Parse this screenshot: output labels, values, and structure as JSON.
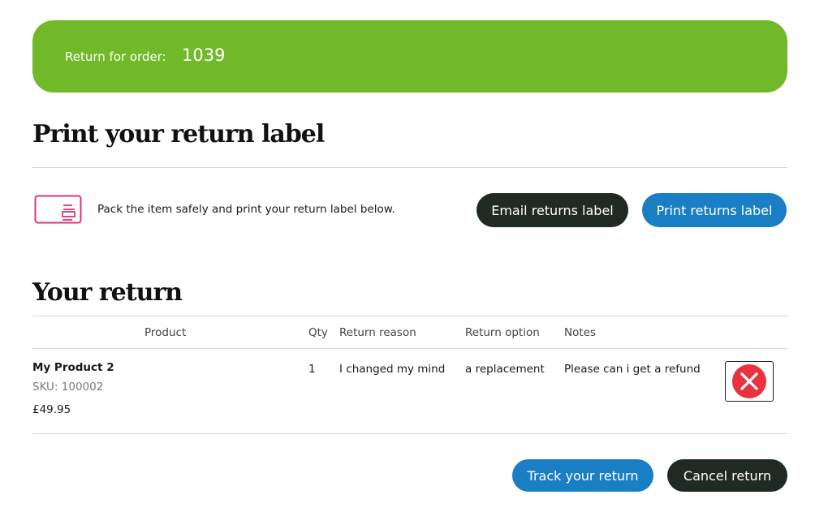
{
  "banner": {
    "label": "Return for order:",
    "order_number": "1039"
  },
  "print_section": {
    "title": "Print your return label",
    "instruction": "Pack the item safely and print your return label below.",
    "email_button": "Email returns label",
    "print_button": "Print returns label"
  },
  "return_section": {
    "title": "Your return",
    "columns": {
      "product": "Product",
      "qty": "Qty",
      "reason": "Return reason",
      "option": "Return option",
      "notes": "Notes"
    },
    "rows": [
      {
        "product_name": "My Product 2",
        "sku": "SKU: 100002",
        "price": "£49.95",
        "qty": "1",
        "reason": "I changed my mind",
        "option": "a replacement",
        "notes": "Please can i get a refund"
      }
    ]
  },
  "actions": {
    "track": "Track your return",
    "cancel": "Cancel return"
  },
  "colors": {
    "banner": "#72b92a",
    "dark_button": "#1f2a24",
    "blue_button": "#1a7ec5",
    "remove_icon": "#e8333f",
    "label_icon": "#d9367f"
  },
  "icons": {
    "label": "return-label-icon",
    "remove": "remove-item-icon"
  }
}
